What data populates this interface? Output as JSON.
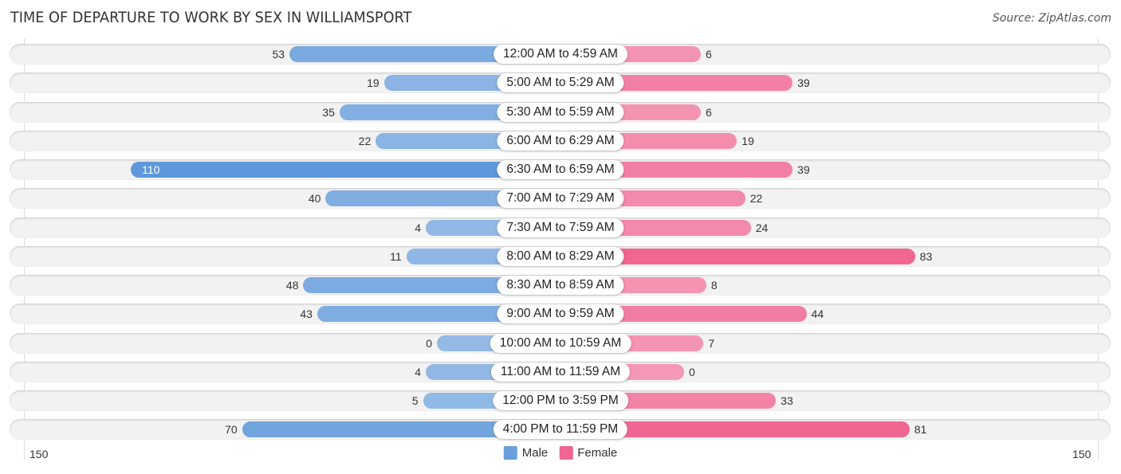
{
  "chart_data": {
    "type": "bar",
    "orientation": "horizontal-diverging",
    "title": "TIME OF DEPARTURE TO WORK BY SEX IN WILLIAMSPORT",
    "source": "Source: ZipAtlas.com",
    "categories": [
      "12:00 AM to 4:59 AM",
      "5:00 AM to 5:29 AM",
      "5:30 AM to 5:59 AM",
      "6:00 AM to 6:29 AM",
      "6:30 AM to 6:59 AM",
      "7:00 AM to 7:29 AM",
      "7:30 AM to 7:59 AM",
      "8:00 AM to 8:29 AM",
      "8:30 AM to 8:59 AM",
      "9:00 AM to 9:59 AM",
      "10:00 AM to 10:59 AM",
      "11:00 AM to 11:59 AM",
      "12:00 PM to 3:59 PM",
      "4:00 PM to 11:59 PM"
    ],
    "series": [
      {
        "name": "Male",
        "color": "#6a9fdc",
        "values": [
          53,
          19,
          35,
          22,
          110,
          40,
          4,
          11,
          48,
          43,
          0,
          4,
          5,
          70
        ]
      },
      {
        "name": "Female",
        "color": "#f06592",
        "values": [
          6,
          39,
          6,
          19,
          39,
          22,
          24,
          83,
          8,
          44,
          7,
          0,
          33,
          81
        ]
      }
    ],
    "axis": {
      "min_label": "150",
      "max_label": "150",
      "range": [
        -150,
        150
      ]
    },
    "legend": {
      "position": "bottom-center",
      "items": [
        "Male",
        "Female"
      ]
    },
    "grid": true
  }
}
